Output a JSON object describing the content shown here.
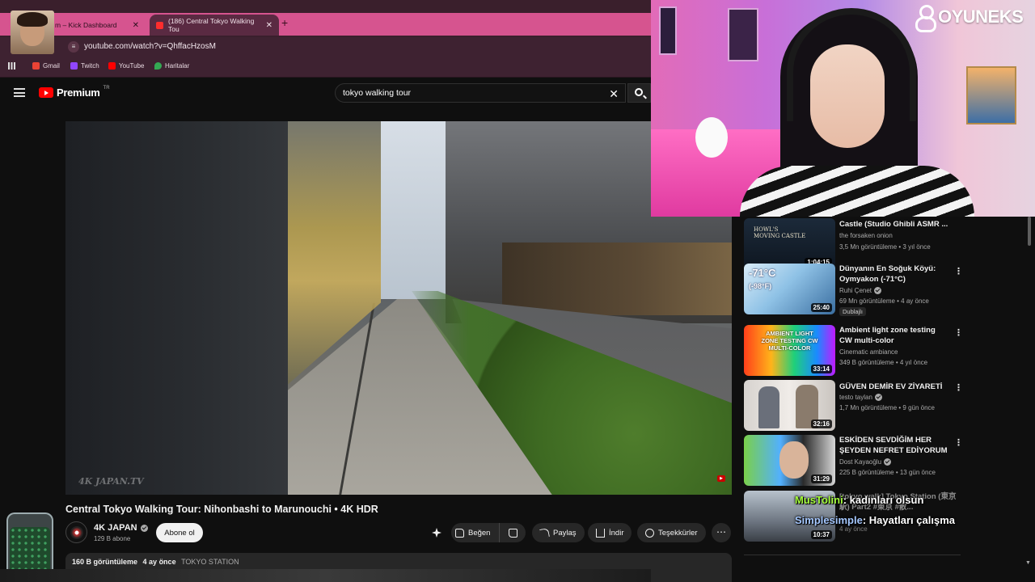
{
  "browser": {
    "tabs": [
      {
        "label": "m – Kick Dashboard"
      },
      {
        "label": "(186) Central Tokyo Walking Tou"
      }
    ],
    "url": "youtube.com/watch?v=QhffacHzosM",
    "bookmarks": [
      {
        "label": "Gmail",
        "color": "#ea4335"
      },
      {
        "label": "Twitch",
        "color": "#9146ff"
      },
      {
        "label": "YouTube",
        "color": "#ff0000"
      },
      {
        "label": "Haritalar",
        "color": "#34a853"
      }
    ]
  },
  "youtube": {
    "logo_text": "Premium",
    "logo_region": "TR",
    "search_value": "tokyo walking tour"
  },
  "video": {
    "watermark": "4K JAPAN.TV",
    "title": "Central Tokyo Walking Tour: Nihonbashi to Marunouchi • 4K HDR",
    "channel": "4K JAPAN",
    "subscribers": "129 B abone",
    "subscribe_label": "Abone ol",
    "like_label": "Beğen",
    "share_label": "Paylaş",
    "download_label": "İndir",
    "thanks_label": "Teşekkürler",
    "views": "160 B görüntüleme",
    "age": "4 ay önce",
    "tag": "TOKYO STATION"
  },
  "recommendations": [
    {
      "title": "Castle (Studio Ghibli ASMR ...",
      "channel": "the forsaken onion",
      "meta": "3,5 Mn görüntüleme • 3 yıl önce",
      "duration": "1:04:15",
      "verified": false,
      "badge": ""
    },
    {
      "title": "Dünyanın En Soğuk Köyü: Oymyakon (-71°C)",
      "channel": "Ruhi Çenet",
      "meta": "69 Mn görüntüleme • 4 ay önce",
      "duration": "25:40",
      "verified": true,
      "badge": "Dublajlı"
    },
    {
      "title": "Ambient light zone testing CW multi-color",
      "channel": "Cinematic ambiance",
      "meta": "349 B görüntüleme • 4 yıl önce",
      "duration": "33:14",
      "verified": false,
      "badge": ""
    },
    {
      "title": "GÜVEN DEMİR EV ZİYARETİ",
      "channel": "testo taylan",
      "meta": "1,7 Mn görüntüleme • 9 gün önce",
      "duration": "32:16",
      "verified": true,
      "badge": ""
    },
    {
      "title": "ESKİDEN SEVDİĞİM HER ŞEYDEN NEFRET EDİYORUM",
      "channel": "Dost Kayaoğlu",
      "meta": "225 B görüntüleme • 13 gün önce",
      "duration": "31:29",
      "verified": true,
      "badge": ""
    },
    {
      "title": "[tokyo walk] Tokyo Station (東京駅) Part2 #東京 #散...",
      "channel": "",
      "meta": "4 ay önce",
      "duration": "10:37",
      "verified": false,
      "badge": ""
    }
  ],
  "overlay": {
    "brand": "OYUNEKS",
    "chat": [
      {
        "user": "MusTolini",
        "message": ": kadınları olsun"
      },
      {
        "user": "Simplesimple",
        "message": ": Hayatları çalışma"
      }
    ]
  }
}
